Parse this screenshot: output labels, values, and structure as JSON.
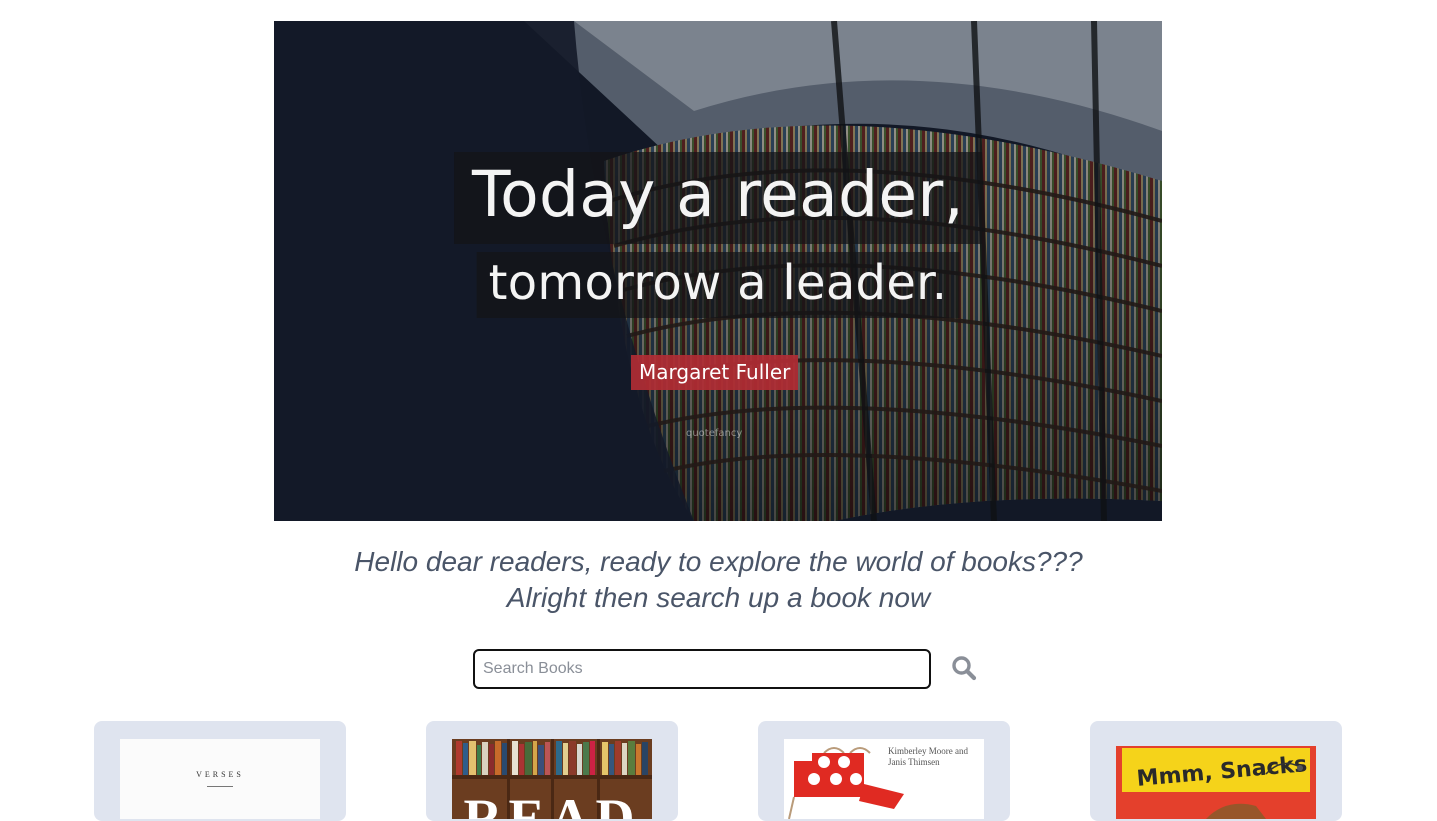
{
  "hero": {
    "quote_line1": "Today a reader,",
    "quote_line2": "tomorrow a leader.",
    "author": "Margaret Fuller",
    "watermark": "quotefancy"
  },
  "greeting": {
    "line1": "Hello dear readers, ready to explore the world of books???",
    "line2": "Alright then search up a book now"
  },
  "search": {
    "placeholder": "Search Books",
    "value": "",
    "icon": "search-icon"
  },
  "books": [
    {
      "cover_text": "VERSES"
    },
    {
      "cover_text": "READ"
    },
    {
      "cover_text": "Kimberley Moore and Janis Thimsen"
    },
    {
      "cover_text": "Mmm, Snacks"
    }
  ],
  "colors": {
    "greeting_text": "#4a5568",
    "card_background": "#dfe4ef",
    "author_badge": "#b12c34"
  }
}
